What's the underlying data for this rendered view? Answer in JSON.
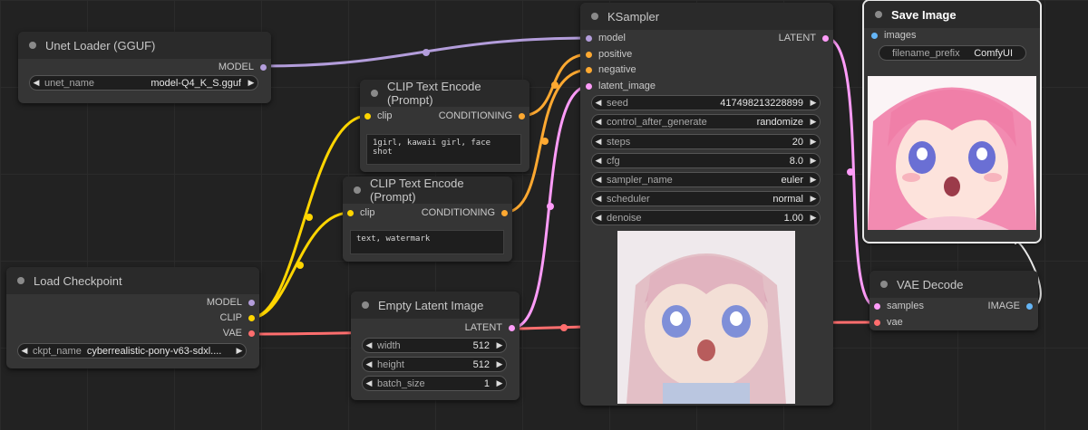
{
  "colors": {
    "model": "#b39ddb",
    "clip": "#ffd500",
    "conditioning": "#ffa931",
    "latent": "#ff9cf9",
    "vae": "#ff6e6e",
    "image": "#64b5f6"
  },
  "unet_loader": {
    "title": "Unet Loader (GGUF)",
    "out_model": "MODEL",
    "w_unet_name": {
      "label": "unet_name",
      "value": "model-Q4_K_S.gguf"
    }
  },
  "load_checkpoint": {
    "title": "Load Checkpoint",
    "out_model": "MODEL",
    "out_clip": "CLIP",
    "out_vae": "VAE",
    "w_ckpt_name": {
      "label": "ckpt_name",
      "value": "cyberrealistic-pony-v63-sdxl...."
    }
  },
  "clip_encode_pos": {
    "title": "CLIP Text Encode (Prompt)",
    "in_clip": "clip",
    "out_cond": "CONDITIONING",
    "text": "1girl, kawaii girl, face shot"
  },
  "clip_encode_neg": {
    "title": "CLIP Text Encode (Prompt)",
    "in_clip": "clip",
    "out_cond": "CONDITIONING",
    "text": "text, watermark"
  },
  "empty_latent": {
    "title": "Empty Latent Image",
    "out_latent": "LATENT",
    "w_width": {
      "label": "width",
      "value": "512"
    },
    "w_height": {
      "label": "height",
      "value": "512"
    },
    "w_batch": {
      "label": "batch_size",
      "value": "1"
    }
  },
  "ksampler": {
    "title": "KSampler",
    "in_model": "model",
    "in_positive": "positive",
    "in_negative": "negative",
    "in_latent": "latent_image",
    "out_latent": "LATENT",
    "w_seed": {
      "label": "seed",
      "value": "417498213228899"
    },
    "w_control": {
      "label": "control_after_generate",
      "value": "randomize"
    },
    "w_steps": {
      "label": "steps",
      "value": "20"
    },
    "w_cfg": {
      "label": "cfg",
      "value": "8.0"
    },
    "w_sampler": {
      "label": "sampler_name",
      "value": "euler"
    },
    "w_scheduler": {
      "label": "scheduler",
      "value": "normal"
    },
    "w_denoise": {
      "label": "denoise",
      "value": "1.00"
    }
  },
  "save_image": {
    "title": "Save Image",
    "in_images": "images",
    "w_prefix": {
      "label": "filename_prefix",
      "value": "ComfyUI"
    }
  },
  "vae_decode": {
    "title": "VAE Decode",
    "in_samples": "samples",
    "in_vae": "vae",
    "out_image": "IMAGE"
  }
}
